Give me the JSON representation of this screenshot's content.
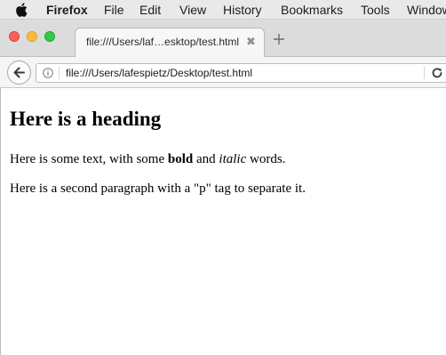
{
  "menubar": {
    "app_name": "Firefox",
    "items": [
      "File",
      "Edit",
      "View",
      "History",
      "Bookmarks",
      "Tools",
      "Window"
    ]
  },
  "tab": {
    "title": "file:///Users/laf…esktop/test.html",
    "close_glyph": "✖"
  },
  "navbar": {
    "url": "file:///Users/lafespietz/Desktop/test.html"
  },
  "page": {
    "heading": "Here is a heading",
    "paragraph1": {
      "text_before": "Here is some text, with some ",
      "bold": "bold",
      "text_middle": " and ",
      "italic": "italic",
      "text_after": " words."
    },
    "paragraph2": "Here is a second paragraph with a \"p\" tag to separate it."
  },
  "colors": {
    "close_button": "#fc605c",
    "minimize_button": "#fdbc40",
    "maximize_button": "#34c84a"
  },
  "icons": [
    "apple-logo-icon",
    "close-icon",
    "plus-icon",
    "back-arrow-icon",
    "info-icon",
    "reload-icon"
  ]
}
